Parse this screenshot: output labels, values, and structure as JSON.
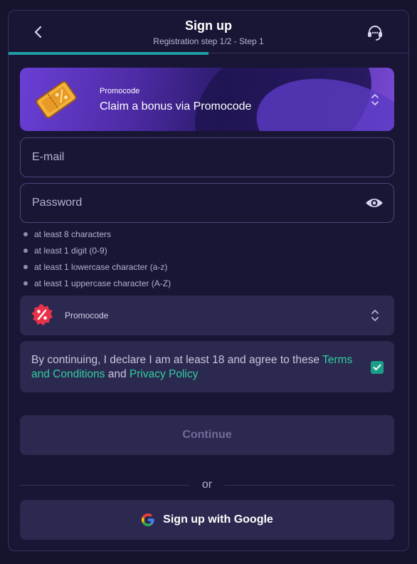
{
  "header": {
    "title": "Sign up",
    "subtitle": "Registration step 1/2 - Step 1",
    "progress_fraction": 0.5
  },
  "promo_banner": {
    "label": "Promocode",
    "text": "Claim a bonus via Promocode",
    "icon": "golden-ticket-icon"
  },
  "email": {
    "placeholder": "E-mail",
    "value": ""
  },
  "password": {
    "placeholder": "Password",
    "value": "",
    "icon": "eye-icon"
  },
  "password_rules": [
    "at least 8 characters",
    "at least 1 digit (0-9)",
    "at least 1 lowercase character (a-z)",
    "at least 1 uppercase character (A-Z)"
  ],
  "promocode_select": {
    "label": "Promocode",
    "icon": "percent-badge-icon"
  },
  "terms": {
    "prefix": "By continuing, I declare I am at least 18 and agree to these ",
    "terms_link": "Terms and Conditions",
    "middle": " and ",
    "privacy_link": "Privacy Policy",
    "checked": true
  },
  "continue_label": "Continue",
  "divider_text": "or",
  "google_label": "Sign up with Google",
  "colors": {
    "background": "#15132e",
    "accent_teal": "#1e9fa6",
    "link_green": "#2fcfa0",
    "checkbox": "#1b9e88",
    "card": "#2c2950"
  }
}
